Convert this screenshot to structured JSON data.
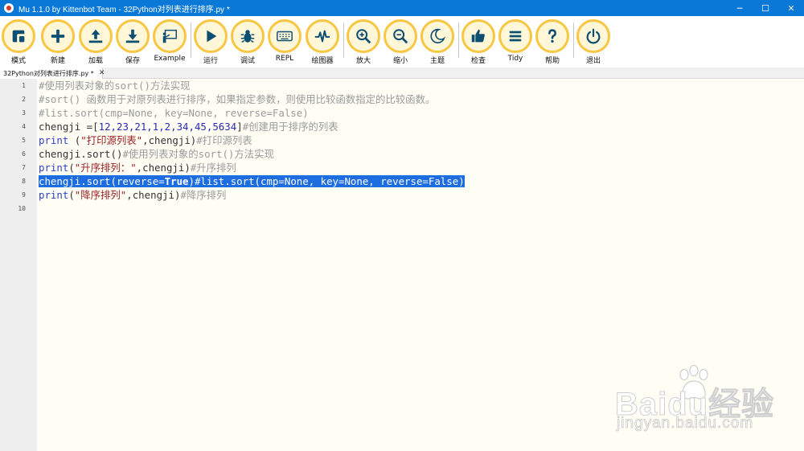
{
  "window": {
    "title": "Mu 1.1.0 by Kittenbot Team - 32Python对列表进行排序.py *",
    "controls": [
      "─",
      "☐",
      "✕"
    ]
  },
  "toolbar": {
    "mode": "模式",
    "new": "新建",
    "load": "加载",
    "save": "保存",
    "example": "Example",
    "run": "运行",
    "debug": "调试",
    "repl": "REPL",
    "plotter": "绘图器",
    "zoom_in": "放大",
    "zoom_out": "缩小",
    "theme": "主题",
    "check": "检查",
    "tidy": "Tidy",
    "help": "帮助",
    "quit": "退出"
  },
  "tabs": [
    {
      "label": "32Python对列表进行排序.py *",
      "close": "✕"
    }
  ],
  "editor": {
    "line_numbers": [
      "1",
      "2",
      "3",
      "4",
      "5",
      "6",
      "7",
      "8",
      "9",
      "10"
    ],
    "lines": {
      "l1": "#使用列表对象的sort()方法实现",
      "l2": "#sort() 函数用于对原列表进行排序，如果指定参数，则使用比较函数指定的比较函数。",
      "l3": "#list.sort(cmp=None, key=None, reverse=False)",
      "l4_a": "chengji =[",
      "l4_nums": "12,23,21,1,2,34,45,5634",
      "l4_b": "]",
      "l4_c": "#创建用于排序的列表",
      "l5_kw": "print",
      "l5_a": " (",
      "l5_str": "\"打印源列表\"",
      "l5_b": ",chengji)",
      "l5_c": "#打印源列表",
      "l6_a": "chengji.sort()",
      "l6_c": "#使用列表对象的sort()方法实现",
      "l7_kw": "print",
      "l7_a": "(",
      "l7_str": "\"升序排列：\"",
      "l7_b": ",chengji)",
      "l7_c": "#升序排列",
      "l8_a": "chengji.sort(reverse=",
      "l8_bold": "True",
      "l8_b": ")#list.sort(cmp=None, key=None, reverse=False)",
      "l9_kw": "print",
      "l9_a": "(",
      "l9_str": "\"降序排列\"",
      "l9_b": ",chengji)",
      "l9_c": "#降序排列"
    }
  },
  "watermark": {
    "brand": "Baidu经验",
    "url": "jingyan.baidu.com"
  },
  "colors": {
    "titlebar": "#0a78d7",
    "button_ring": "#f7c744",
    "button_fill": "#fff7d8",
    "icon": "#0d4f73",
    "selection": "#1d6de0",
    "editor_bg": "#fefef5"
  },
  "icons": [
    "mode-icon",
    "plus-icon",
    "upload-icon",
    "download-icon",
    "presentation-icon",
    "play-icon",
    "bug-icon",
    "keyboard-icon",
    "pulse-icon",
    "zoom-in-icon",
    "zoom-out-icon",
    "moon-icon",
    "thumbs-up-icon",
    "list-icon",
    "question-icon",
    "power-icon"
  ]
}
